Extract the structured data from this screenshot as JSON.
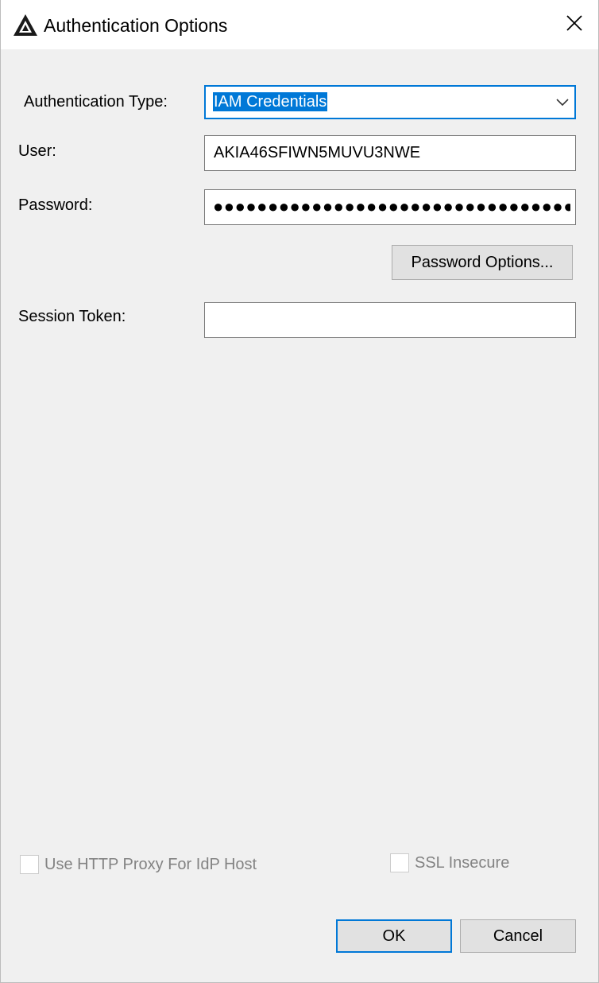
{
  "window": {
    "title": "Authentication Options"
  },
  "form": {
    "auth_type": {
      "label": "Authentication Type:",
      "value": "IAM Credentials",
      "options_visible": [
        "IAM Credentials"
      ]
    },
    "user": {
      "label": "User:",
      "value": "AKIA46SFIWN5MUVU3NWE"
    },
    "password": {
      "label": "Password:",
      "masked_value": "●●●●●●●●●●●●●●●●●●●●●●●●●●●●●●●●●●●●●●●"
    },
    "password_options_button": "Password Options...",
    "session_token": {
      "label": "Session Token:",
      "value": ""
    }
  },
  "options": {
    "use_http_proxy": {
      "label": "Use HTTP Proxy For IdP Host",
      "checked": false,
      "enabled": false
    },
    "ssl_insecure": {
      "label": "SSL Insecure",
      "checked": false,
      "enabled": false
    }
  },
  "footer": {
    "ok_label": "OK",
    "cancel_label": "Cancel"
  },
  "colors": {
    "accent": "#0078d7",
    "dialog_background": "#f0f0f0",
    "disabled_text": "#838383"
  },
  "icons": {
    "app": "app-logo-icon",
    "close": "close-icon",
    "dropdown": "chevron-down-icon"
  }
}
